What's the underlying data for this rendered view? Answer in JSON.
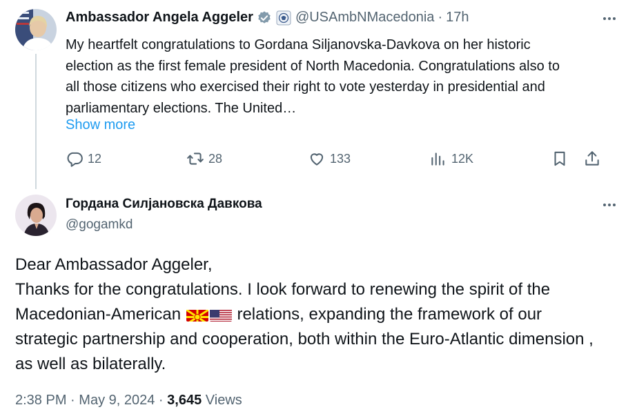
{
  "parent_tweet": {
    "author_name": "Ambassador Angela Aggeler",
    "handle": "@USAmbNMacedonia",
    "separator": "·",
    "time": "17h",
    "text": "My heartfelt congratulations to Gordana Siljanovska-Davkova on her historic election as the first female president of North Macedonia. Congratulations also to all those citizens who exercised their right to vote yesterday in presidential and parliamentary elections. The United…",
    "show_more": "Show more",
    "actions": {
      "replies": "12",
      "reposts": "28",
      "likes": "133",
      "views": "12K"
    }
  },
  "reply_tweet": {
    "author_name": "Гордана Силјановска Давкова",
    "handle": "@gogamkd",
    "text_line1": "Dear Ambassador Aggeler,",
    "text_part1": "Thanks for the congratulations. I look forward to renewing the spirit of the Macedonian-American",
    "text_part2": "relations, expanding the framework of our strategic partnership and cooperation, both within the Euro-Atlantic dimension , as well as bilaterally.",
    "flags": [
      "north-macedonia-flag",
      "us-flag"
    ],
    "time": "2:38 PM",
    "date": "May 9, 2024",
    "separator": "·",
    "views_count": "3,645",
    "views_label": "Views"
  },
  "colors": {
    "link": "#1d9bf0",
    "muted": "#536471",
    "text": "#0f1419",
    "verified": "#829aab"
  }
}
